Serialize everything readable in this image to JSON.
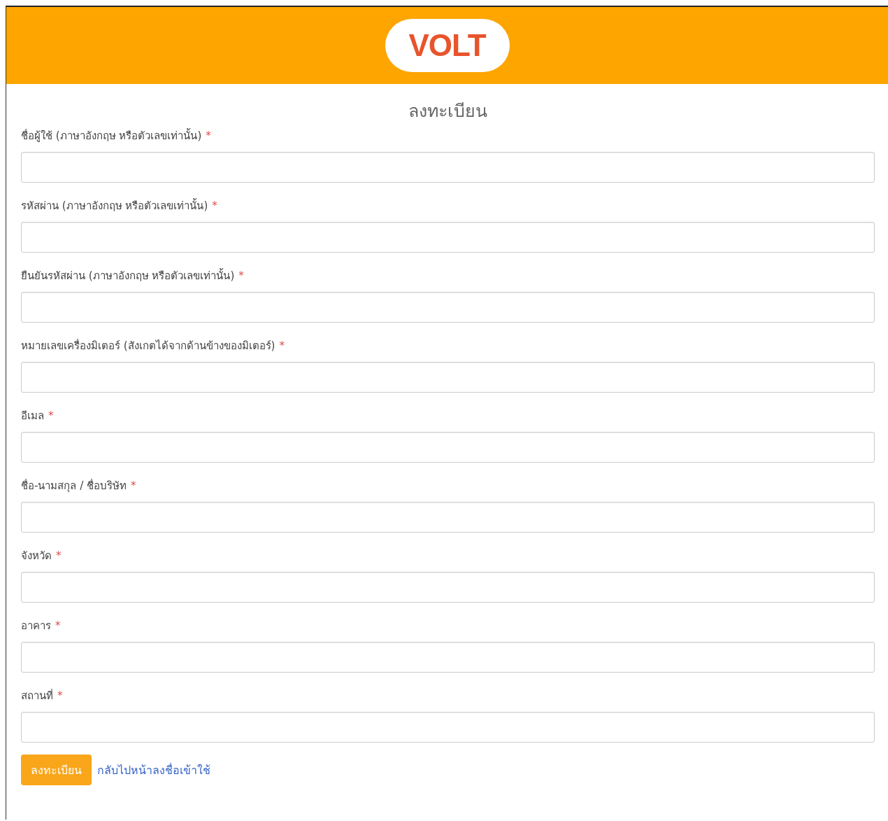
{
  "header": {
    "logo": "VOLT"
  },
  "title": "ลงทะเบียน",
  "fields": [
    {
      "label": "ชื่อผู้ใช้ (ภาษาอังกฤษ หรือตัวเลขเท่านั้น)",
      "required_mark": "*"
    },
    {
      "label": "รหัสผ่าน (ภาษาอังกฤษ หรือตัวเลขเท่านั้น)",
      "required_mark": "*"
    },
    {
      "label": "ยืนยันรหัสผ่าน (ภาษาอังกฤษ หรือตัวเลขเท่านั้น)",
      "required_mark": "*"
    },
    {
      "label": "หมายเลขเครื่องมิเตอร์ (สังเกตได้จากด้านข้างของมิเตอร์)",
      "required_mark": "*"
    },
    {
      "label": "อีเมล",
      "required_mark": "*"
    },
    {
      "label": "ชื่อ-นามสกุล / ชื่อบริษัท",
      "required_mark": "*"
    },
    {
      "label": "จังหวัด",
      "required_mark": "*"
    },
    {
      "label": "อาคาร",
      "required_mark": "*"
    },
    {
      "label": "สถานที่",
      "required_mark": "*"
    }
  ],
  "submit_button": "ลงทะเบียน",
  "back_link": "กลับไปหน้าลงชื่อเข้าใช้"
}
